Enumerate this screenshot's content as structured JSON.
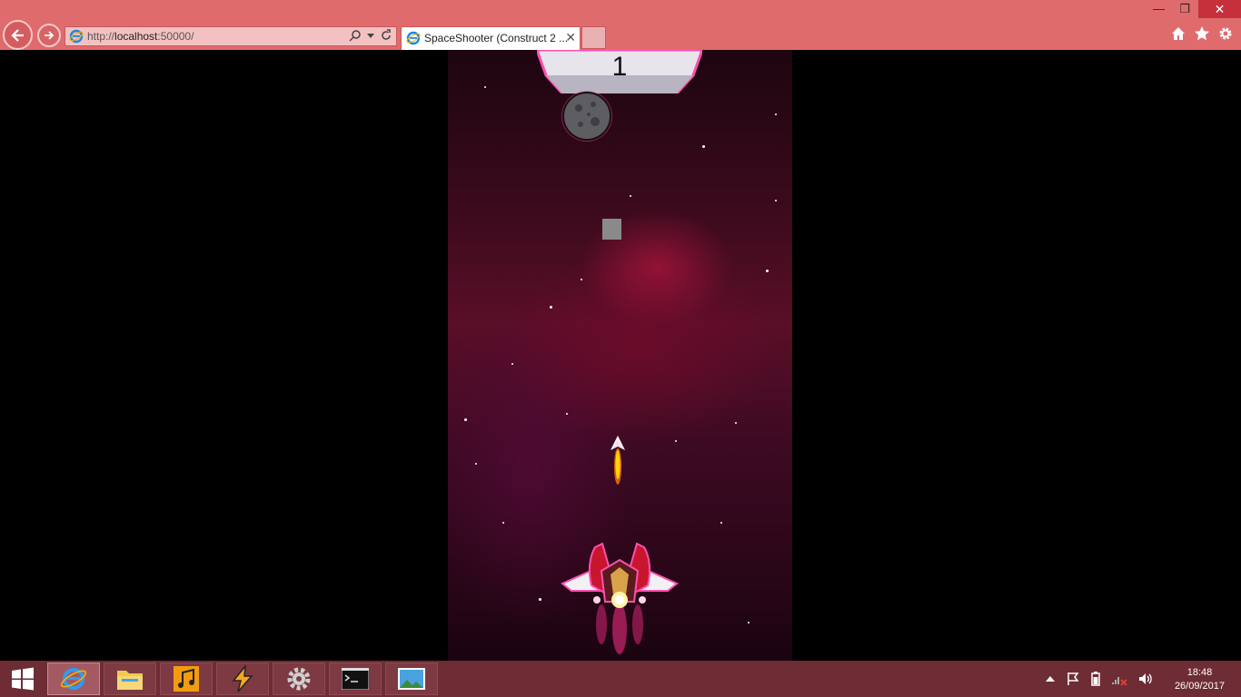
{
  "browser": {
    "url_prefix": "http://",
    "url_host": "localhost",
    "url_rest": ":50000/",
    "tab_title": "SpaceShooter (Construct 2 ...",
    "tab_close": "✕",
    "window_minimize": "—",
    "window_restore": "❐",
    "window_close": "✕"
  },
  "game": {
    "score": "1"
  },
  "taskbar": {
    "apps": [
      "internet-explorer",
      "file-explorer",
      "music-app",
      "winamp",
      "settings",
      "command-prompt",
      "photo-viewer"
    ],
    "time": "18:48",
    "date": "26/09/2017"
  },
  "colors": {
    "chrome": "#e06b6d",
    "taskbar": "#6e2c34",
    "close_button": "#c6303b"
  }
}
